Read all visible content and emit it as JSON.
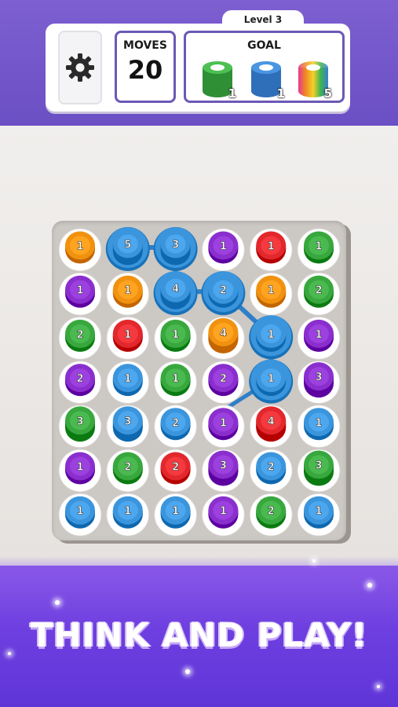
{
  "hud": {
    "level_label": "Level 3",
    "moves_label": "MOVES",
    "moves_value": "20",
    "goal_label": "GOAL",
    "goals": [
      {
        "icon": "green-cylinder-icon",
        "color": "#3da544",
        "count": "1"
      },
      {
        "icon": "blue-cylinder-icon",
        "color": "#3a7fd0",
        "count": "1"
      },
      {
        "icon": "rainbow-cylinder-icon",
        "color": "rainbow",
        "count": "5"
      }
    ]
  },
  "colors": {
    "orange": "#f0920f",
    "purple": "#8a2fce",
    "green": "#38a83e",
    "red": "#e2282d",
    "blue": "#3b95dc"
  },
  "board": {
    "rows": [
      [
        {
          "c": "orange",
          "n": "1"
        },
        {
          "c": "blue",
          "n": "5",
          "sel": true
        },
        {
          "c": "blue",
          "n": "3",
          "sel": true
        },
        {
          "c": "purple",
          "n": "1"
        },
        {
          "c": "red",
          "n": "1"
        },
        {
          "c": "green",
          "n": "1"
        }
      ],
      [
        {
          "c": "purple",
          "n": "1"
        },
        {
          "c": "orange",
          "n": "1"
        },
        {
          "c": "blue",
          "n": "4",
          "sel": true
        },
        {
          "c": "blue",
          "n": "2",
          "sel": true
        },
        {
          "c": "orange",
          "n": "1"
        },
        {
          "c": "green",
          "n": "2"
        }
      ],
      [
        {
          "c": "green",
          "n": "2"
        },
        {
          "c": "red",
          "n": "1"
        },
        {
          "c": "green",
          "n": "1"
        },
        {
          "c": "orange",
          "n": "4"
        },
        {
          "c": "blue",
          "n": "1",
          "sel": true
        },
        {
          "c": "purple",
          "n": "1"
        }
      ],
      [
        {
          "c": "purple",
          "n": "2"
        },
        {
          "c": "blue",
          "n": "1"
        },
        {
          "c": "green",
          "n": "1"
        },
        {
          "c": "purple",
          "n": "2"
        },
        {
          "c": "blue",
          "n": "1",
          "sel": true
        },
        {
          "c": "purple",
          "n": "3"
        }
      ],
      [
        {
          "c": "green",
          "n": "3"
        },
        {
          "c": "blue",
          "n": "3"
        },
        {
          "c": "blue",
          "n": "2"
        },
        {
          "c": "purple",
          "n": "1"
        },
        {
          "c": "red",
          "n": "4"
        },
        {
          "c": "blue",
          "n": "1"
        }
      ],
      [
        {
          "c": "purple",
          "n": "1"
        },
        {
          "c": "green",
          "n": "2"
        },
        {
          "c": "red",
          "n": "2"
        },
        {
          "c": "purple",
          "n": "3"
        },
        {
          "c": "blue",
          "n": "2"
        },
        {
          "c": "green",
          "n": "3"
        }
      ],
      [
        {
          "c": "blue",
          "n": "1"
        },
        {
          "c": "blue",
          "n": "1"
        },
        {
          "c": "blue",
          "n": "1"
        },
        {
          "c": "purple",
          "n": "1"
        },
        {
          "c": "green",
          "n": "2"
        },
        {
          "c": "blue",
          "n": "1"
        }
      ]
    ],
    "path": [
      [
        0,
        1
      ],
      [
        0,
        2
      ],
      [
        1,
        2
      ],
      [
        1,
        3
      ],
      [
        2,
        4
      ],
      [
        3,
        4
      ]
    ]
  },
  "tagline": "THINK AND PLAY!"
}
